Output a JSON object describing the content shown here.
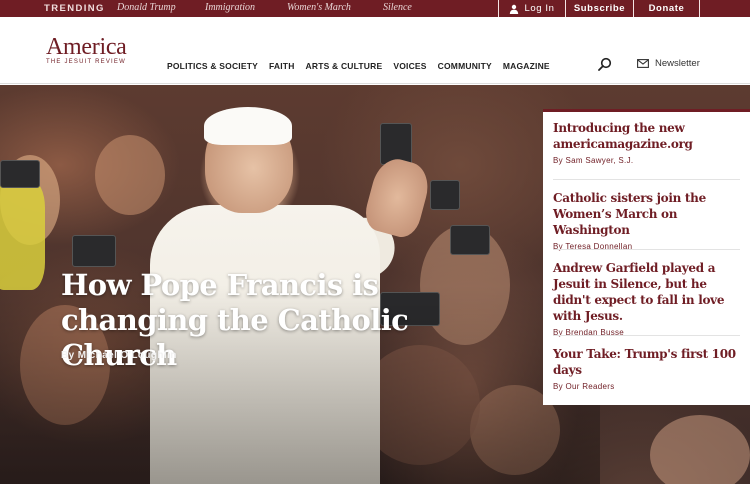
{
  "trending": {
    "label": "TRENDING",
    "items": [
      "Donald Trump",
      "Immigration",
      "Women's March",
      "Silence"
    ]
  },
  "top_actions": {
    "login": "Log In",
    "subscribe": "Subscribe",
    "donate": "Donate"
  },
  "logo": {
    "name": "America",
    "tagline": "THE JESUIT REVIEW"
  },
  "nav": [
    "POLITICS & SOCIETY",
    "FAITH",
    "ARTS & CULTURE",
    "VOICES",
    "COMMUNITY",
    "MAGAZINE"
  ],
  "newsletter_label": "Newsletter",
  "hero": {
    "title": "How Pope Francis is changing the Catholic Church",
    "byline": "By Michael O'Loughlin"
  },
  "side_articles": [
    {
      "title": "Introducing the new americamagazine.org",
      "byline": "By Sam Sawyer, S.J."
    },
    {
      "title": "Catholic sisters join the Women’s March on Washington",
      "byline": "By Teresa Donnellan"
    },
    {
      "title": "Andrew Garfield played a Jesuit in Silence, but he didn't expect to fall in love with Jesus.",
      "byline": "By Brendan Busse"
    },
    {
      "title": "Your Take: Trump's first 100 days",
      "byline": "By Our Readers"
    }
  ],
  "colors": {
    "brand": "#6f1d24",
    "white": "#ffffff"
  },
  "icons": [
    "user-icon",
    "search-icon",
    "envelope-icon"
  ]
}
